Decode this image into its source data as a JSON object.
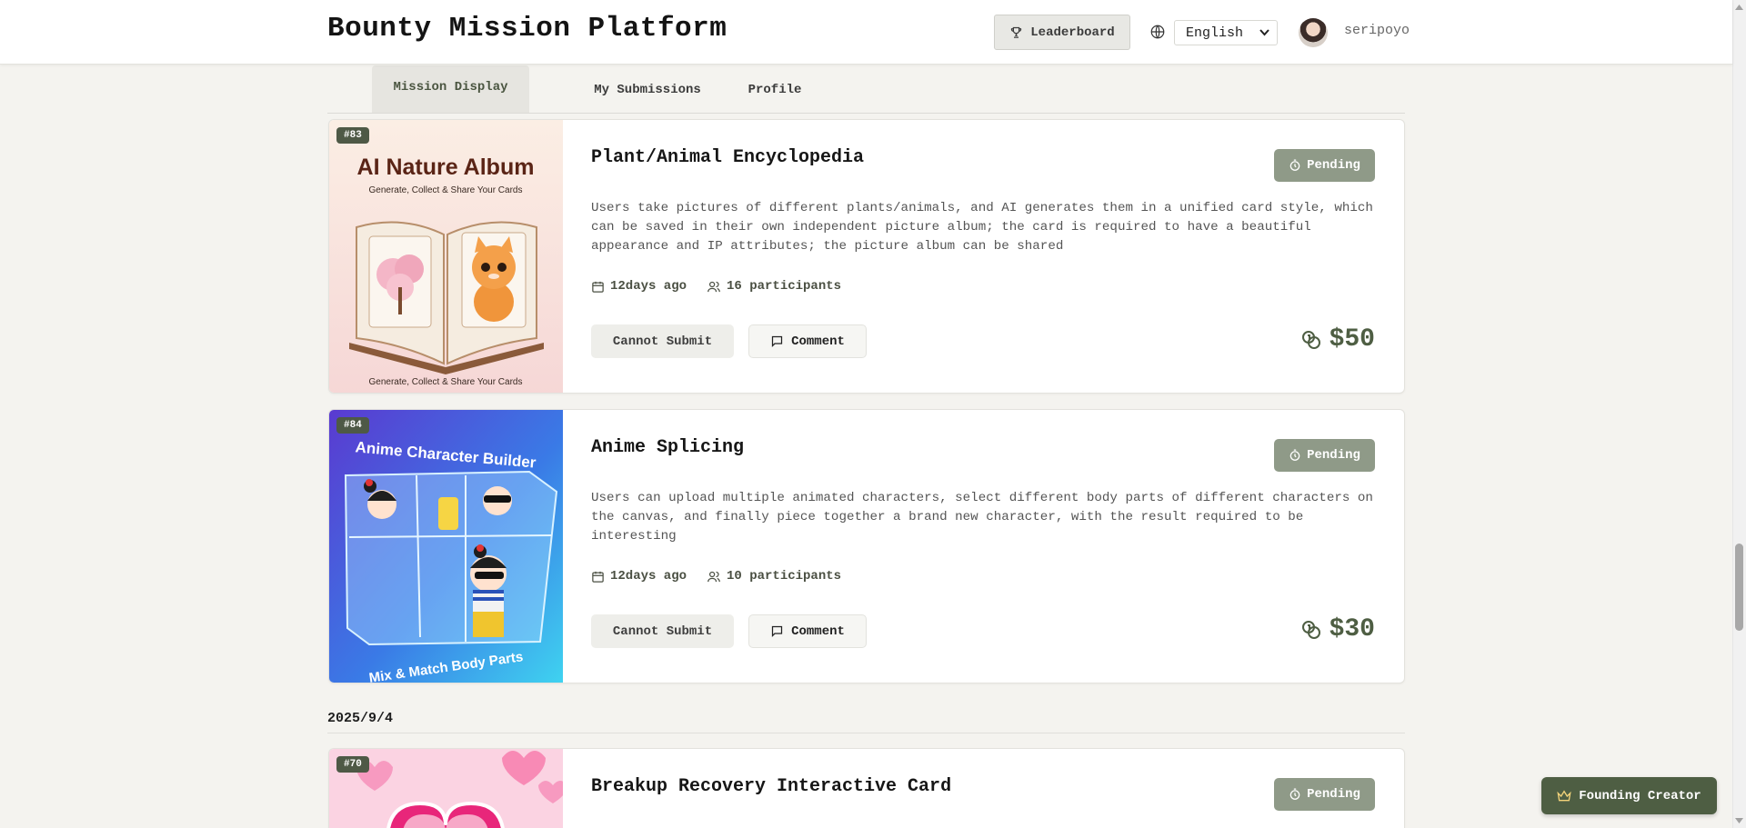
{
  "header": {
    "brand": "Bounty Mission Platform",
    "leaderboard_label": "Leaderboard",
    "language": "English",
    "username": "seripoyo"
  },
  "tabs": [
    {
      "label": "Mission Display",
      "active": true
    },
    {
      "label": "My Submissions",
      "active": false
    },
    {
      "label": "Profile",
      "active": false
    }
  ],
  "missions": [
    {
      "id": "#83",
      "title": "Plant/Animal Encyclopedia",
      "status": "Pending",
      "description": "Users take pictures of different plants/animals, and AI generates them in a unified card style, which can be saved in their own independent picture album; the card is required to have a beautiful appearance and IP attributes; the picture album can be shared",
      "posted": "12days ago",
      "participants": "16 participants",
      "submit_label": "Cannot Submit",
      "comment_label": "Comment",
      "reward": "$50",
      "image": {
        "title": "AI Nature Album",
        "subtitle": "Generate, Collect & Share Your Cards",
        "footer": "Generate, Collect & Share Your Cards"
      }
    },
    {
      "id": "#84",
      "title": "Anime Splicing",
      "status": "Pending",
      "description": "Users can upload multiple animated characters, select different body parts of different characters on the canvas, and finally piece together a brand new character, with the result required to be interesting",
      "posted": "12days ago",
      "participants": "10 participants",
      "submit_label": "Cannot Submit",
      "comment_label": "Comment",
      "reward": "$30",
      "image": {
        "title": "Anime Character Builder",
        "footer": "Mix & Match Body Parts"
      }
    },
    {
      "id": "#70",
      "title": "Breakup Recovery Interactive Card",
      "status": "Pending"
    }
  ],
  "date_group": "2025/9/4",
  "founding_label": "Founding Creator",
  "colors": {
    "accent": "#4e5e43",
    "status_bg": "#8f9a88",
    "badge": "#4e5946",
    "page_bg": "#f4f3ef"
  }
}
